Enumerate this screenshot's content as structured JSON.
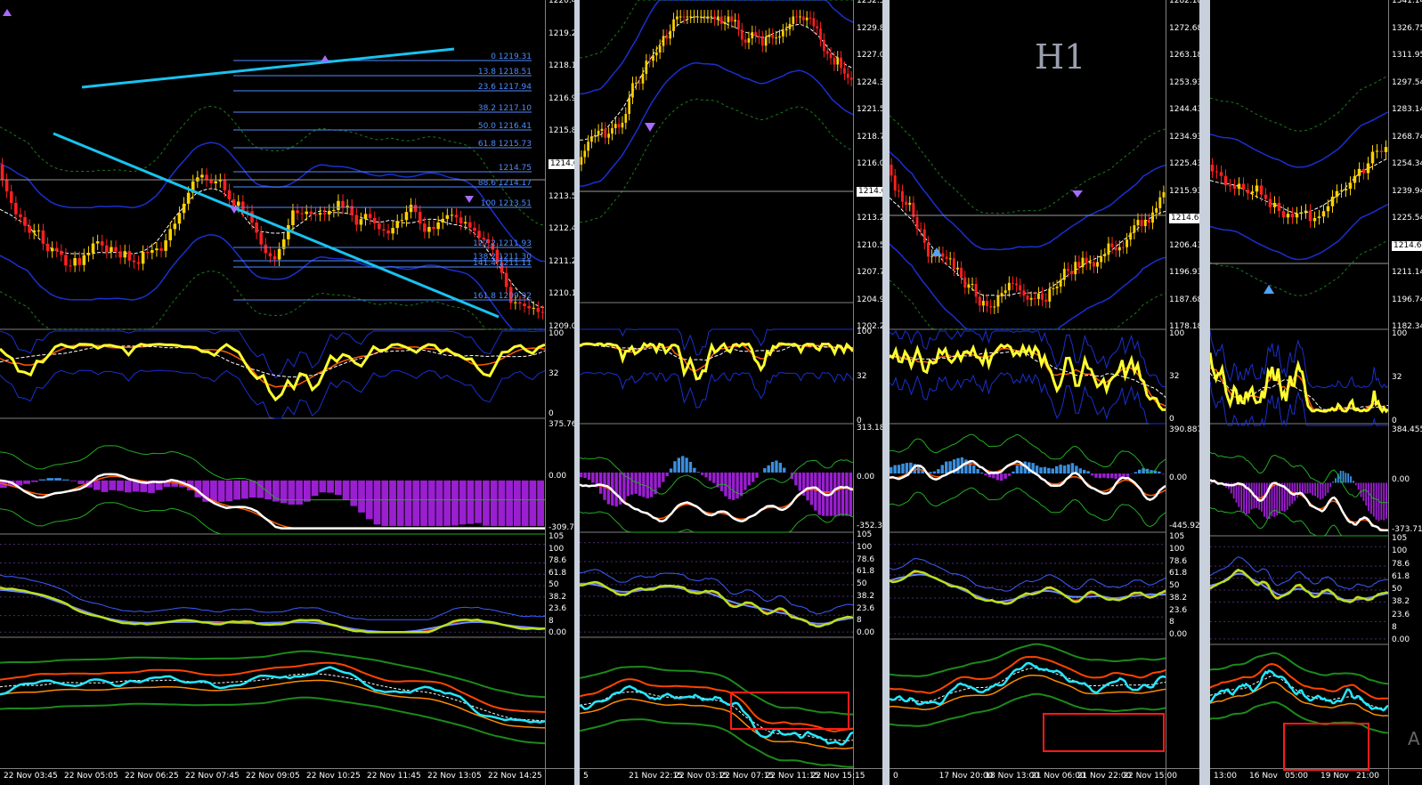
{
  "colors": {
    "bull": "#ffd200",
    "bear": "#ff2020",
    "fib": "#4f8cff",
    "trend": "#19c3f0",
    "highlight": "#ff1a1a",
    "separator": "#c8d0dc"
  },
  "chart1": {
    "price_ticks": [
      "1220.40",
      "1219.25",
      "1218.10",
      "1216.95",
      "1215.85",
      "1214.64",
      "1213.55",
      "1212.40",
      "1211.25",
      "1210.10",
      "1209.00"
    ],
    "current_price": "1214.64",
    "fib_levels": [
      "0 1219.31",
      "13.8 1218.51",
      "23.6 1217.94",
      "38.2 1217.10",
      "50.0 1216.41",
      "61.8 1215.73",
      "1214.75",
      "88.6 1214.17",
      "100 1213.51",
      "127.2 1211.93",
      "138.2 1211.30",
      "141.4 1211.11",
      "161.8 1209.92"
    ],
    "rsi_ticks": [
      "100",
      "32",
      "0"
    ],
    "macd_ticks": [
      "375.7683",
      "0.00",
      "-309.7255"
    ],
    "stoch_ticks": [
      "105",
      "100",
      "78.6",
      "61.8",
      "50",
      "38.2",
      "23.6",
      "8",
      "0.00"
    ],
    "time_labels": [
      "22 Nov 03:45",
      "22 Nov 05:05",
      "22 Nov 06:25",
      "22 Nov 07:45",
      "22 Nov 09:05",
      "22 Nov 10:25",
      "22 Nov 11:45",
      "22 Nov 13:05",
      "22 Nov 14:25"
    ]
  },
  "chart2": {
    "price_ticks": [
      "1232.55",
      "1229.80",
      "1227.05",
      "1224.30",
      "1221.55",
      "1218.75",
      "1216.00",
      "1214.64",
      "1213.25",
      "1210.50",
      "1207.70",
      "1204.95",
      "1202.20"
    ],
    "current_price": "1214.64",
    "rsi_ticks": [
      "100",
      "32",
      "0"
    ],
    "macd_ticks": [
      "313.1808",
      "0.00",
      "-352.305"
    ],
    "stoch_ticks": [
      "105",
      "100",
      "78.6",
      "61.8",
      "50",
      "38.2",
      "23.6",
      "8",
      "0.00"
    ],
    "time_labels": [
      "5",
      "21 Nov 22:15",
      "22 Nov 03:15",
      "22 Nov 07:15",
      "22 Nov 11:15",
      "22 Nov 15:15"
    ]
  },
  "chart3": {
    "timeframe": "H1",
    "price_ticks": [
      "1282.18",
      "1272.68",
      "1263.18",
      "1253.93",
      "1244.43",
      "1234.93",
      "1225.43",
      "1215.93",
      "1214.64",
      "1206.43",
      "1196.93",
      "1187.68",
      "1178.18"
    ],
    "current_price": "1214.64",
    "rsi_ticks": [
      "100",
      "32",
      "0"
    ],
    "macd_ticks": [
      "390.8871",
      "0.00",
      "-445.9201"
    ],
    "stoch_ticks": [
      "105",
      "100",
      "78.6",
      "61.8",
      "50",
      "38.2",
      "23.6",
      "8",
      "0.00"
    ],
    "time_labels": [
      "0",
      "17 Nov 20:00",
      "18 Nov 13:00",
      "21 Nov 06:00",
      "21 Nov 22:00",
      "22 Nov 15:00"
    ]
  },
  "chart4": {
    "price_ticks": [
      "1341.14",
      "1326.75",
      "1311.95",
      "1297.54",
      "1283.14",
      "1268.74",
      "1254.34",
      "1239.94",
      "1225.54",
      "1214.64",
      "1211.14",
      "1196.74",
      "1182.34"
    ],
    "current_price": "1214.64",
    "rsi_ticks": [
      "100",
      "32",
      "0"
    ],
    "macd_ticks": [
      "384.4553",
      "0.00",
      "-373.7152"
    ],
    "stoch_ticks": [
      "105",
      "100",
      "78.6",
      "61.8",
      "50",
      "38.2",
      "23.6",
      "8",
      "0.00"
    ],
    "time_labels": [
      "13:00",
      "16 Nov",
      "05:00",
      "19 Nov",
      "21:00"
    ],
    "corner_letter": "A"
  }
}
